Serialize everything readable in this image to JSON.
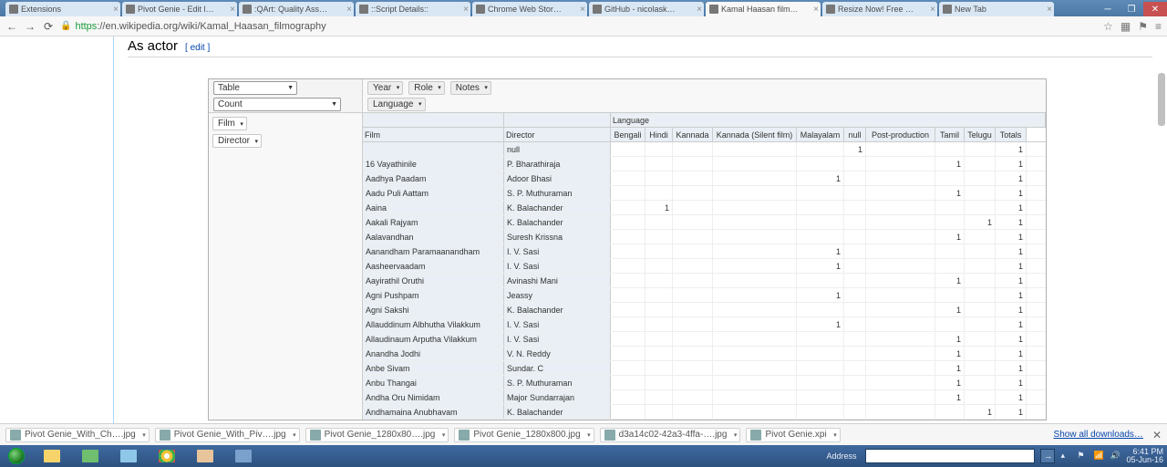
{
  "tabs": [
    {
      "title": "Extensions"
    },
    {
      "title": "Pivot Genie - Edit l…"
    },
    {
      "title": ":QArt: Quality Ass…"
    },
    {
      "title": "::Script Details::"
    },
    {
      "title": "Chrome Web Stor…"
    },
    {
      "title": "GitHub - nicolask…"
    },
    {
      "title": "Kamal Haasan film…",
      "active": true
    },
    {
      "title": "Resize Now! Free …"
    },
    {
      "title": "New Tab"
    }
  ],
  "url": {
    "https": "https",
    "rest": "://en.wikipedia.org/wiki/Kamal_Haasan_filmography"
  },
  "section": {
    "title": "As actor",
    "edit": "[ edit ]"
  },
  "pivot": {
    "render_select": "Table",
    "agg_select": "Count",
    "col_dim": "Language",
    "attrs": [
      "Year",
      "Role",
      "Notes"
    ],
    "row_fields": [
      "Film",
      "Director"
    ],
    "row_axis": [
      "Film",
      "Director"
    ],
    "cols": [
      "Bengali",
      "Hindi",
      "Kannada",
      "Kannada (Silent film)",
      "Malayalam",
      "null",
      "Post-production",
      "Tamil",
      "Telugu",
      "Totals"
    ],
    "rows": [
      {
        "film": "",
        "dir": "null",
        "v": [
          "",
          "",
          "",
          "",
          "",
          "1",
          "",
          "",
          "",
          "1"
        ]
      },
      {
        "film": "16 Vayathinile",
        "dir": "P. Bharathiraja",
        "v": [
          "",
          "",
          "",
          "",
          "",
          "",
          "",
          "1",
          "",
          "1"
        ]
      },
      {
        "film": "Aadhya Paadam",
        "dir": "Adoor Bhasi",
        "v": [
          "",
          "",
          "",
          "",
          "1",
          "",
          "",
          "",
          "",
          "1"
        ]
      },
      {
        "film": "Aadu Puli Aattam",
        "dir": "S. P. Muthuraman",
        "v": [
          "",
          "",
          "",
          "",
          "",
          "",
          "",
          "1",
          "",
          "1"
        ]
      },
      {
        "film": "Aaina",
        "dir": "K. Balachander",
        "v": [
          "",
          "1",
          "",
          "",
          "",
          "",
          "",
          "",
          "",
          "1"
        ]
      },
      {
        "film": "Aakali Rajyam",
        "dir": "K. Balachander",
        "v": [
          "",
          "",
          "",
          "",
          "",
          "",
          "",
          "",
          "1",
          "1"
        ]
      },
      {
        "film": "Aalavandhan",
        "dir": "Suresh Krissna",
        "v": [
          "",
          "",
          "",
          "",
          "",
          "",
          "",
          "1",
          "",
          "1"
        ]
      },
      {
        "film": "Aanandham Paramaanandham",
        "dir": "I. V. Sasi",
        "v": [
          "",
          "",
          "",
          "",
          "1",
          "",
          "",
          "",
          "",
          "1"
        ]
      },
      {
        "film": "Aasheervaadam",
        "dir": "I. V. Sasi",
        "v": [
          "",
          "",
          "",
          "",
          "1",
          "",
          "",
          "",
          "",
          "1"
        ]
      },
      {
        "film": "Aayirathil Oruthi",
        "dir": "Avinashi Mani",
        "v": [
          "",
          "",
          "",
          "",
          "",
          "",
          "",
          "1",
          "",
          "1"
        ]
      },
      {
        "film": "Agni Pushpam",
        "dir": "Jeassy",
        "v": [
          "",
          "",
          "",
          "",
          "1",
          "",
          "",
          "",
          "",
          "1"
        ]
      },
      {
        "film": "Agni Sakshi",
        "dir": "K. Balachander",
        "v": [
          "",
          "",
          "",
          "",
          "",
          "",
          "",
          "1",
          "",
          "1"
        ]
      },
      {
        "film": "Allauddinum Albhutha Vilakkum",
        "dir": "I. V. Sasi",
        "v": [
          "",
          "",
          "",
          "",
          "1",
          "",
          "",
          "",
          "",
          "1"
        ]
      },
      {
        "film": "Allaudinaum Arputha Vilakkum",
        "dir": "I. V. Sasi",
        "v": [
          "",
          "",
          "",
          "",
          "",
          "",
          "",
          "1",
          "",
          "1"
        ]
      },
      {
        "film": "Anandha Jodhi",
        "dir": "V. N. Reddy",
        "v": [
          "",
          "",
          "",
          "",
          "",
          "",
          "",
          "1",
          "",
          "1"
        ]
      },
      {
        "film": "Anbe Sivam",
        "dir": "Sundar. C",
        "v": [
          "",
          "",
          "",
          "",
          "",
          "",
          "",
          "1",
          "",
          "1"
        ]
      },
      {
        "film": "Anbu Thangai",
        "dir": "S. P. Muthuraman",
        "v": [
          "",
          "",
          "",
          "",
          "",
          "",
          "",
          "1",
          "",
          "1"
        ]
      },
      {
        "film": "Andha Oru Nimidam",
        "dir": "Major Sundarrajan",
        "v": [
          "",
          "",
          "",
          "",
          "",
          "",
          "",
          "1",
          "",
          "1"
        ]
      },
      {
        "film": "Andhamaina Anubhavam",
        "dir": "K. Balachander",
        "v": [
          "",
          "",
          "",
          "",
          "",
          "",
          "",
          "",
          "1",
          "1"
        ]
      }
    ]
  },
  "downloads": {
    "items": [
      "Pivot Genie_With_Ch….jpg",
      "Pivot Genie_With_Piv….jpg",
      "Pivot Genie_1280x80….jpg",
      "Pivot Genie_1280x800.jpg",
      "d3a14c02-42a3-4ffa-….jpg",
      "Pivot Genie.xpi"
    ],
    "show_all": "Show all downloads…"
  },
  "taskbar": {
    "address_label": "Address",
    "time": "6:41 PM",
    "date": "05-Jun-16"
  }
}
